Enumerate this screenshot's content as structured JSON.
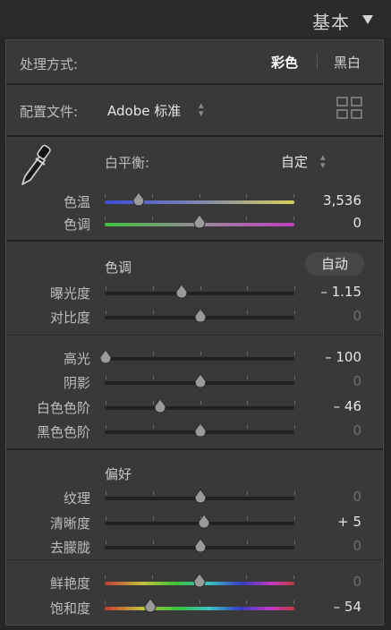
{
  "header": {
    "title": "基本"
  },
  "treatment": {
    "label": "处理方式:",
    "color": "彩色",
    "bw": "黑白"
  },
  "profile": {
    "label": "配置文件:",
    "value": "Adobe 标准"
  },
  "wb": {
    "label": "白平衡:",
    "value": "自定"
  },
  "tone": {
    "title": "色调",
    "auto": "自动"
  },
  "presence": {
    "title": "偏好"
  },
  "sliders": [
    {
      "key": "temp",
      "label": "色温",
      "value": "3,536",
      "pos": 0.18,
      "track": "temp",
      "dim": false
    },
    {
      "key": "tint",
      "label": "色调",
      "value": "0",
      "pos": 0.5,
      "track": "tint",
      "dim": false
    },
    {
      "key": "exposure",
      "label": "曝光度",
      "value": "– 1.15",
      "pos": 0.4,
      "track": "gray",
      "dim": false
    },
    {
      "key": "contrast",
      "label": "对比度",
      "value": "0",
      "pos": 0.5,
      "track": "gray",
      "dim": true
    },
    {
      "key": "highlights",
      "label": "高光",
      "value": "– 100",
      "pos": 0.0,
      "track": "gray",
      "dim": false
    },
    {
      "key": "shadows",
      "label": "阴影",
      "value": "0",
      "pos": 0.5,
      "track": "gray",
      "dim": true
    },
    {
      "key": "whites",
      "label": "白色色阶",
      "value": "– 46",
      "pos": 0.29,
      "track": "gray",
      "dim": false
    },
    {
      "key": "blacks",
      "label": "黑色色阶",
      "value": "0",
      "pos": 0.5,
      "track": "gray",
      "dim": true
    },
    {
      "key": "texture",
      "label": "纹理",
      "value": "0",
      "pos": 0.5,
      "track": "gray",
      "dim": true
    },
    {
      "key": "clarity",
      "label": "清晰度",
      "value": "+ 5",
      "pos": 0.52,
      "track": "gray",
      "dim": false
    },
    {
      "key": "dehaze",
      "label": "去朦胧",
      "value": "0",
      "pos": 0.5,
      "track": "gray",
      "dim": true
    },
    {
      "key": "vibrance",
      "label": "鲜艳度",
      "value": "0",
      "pos": 0.5,
      "track": "rainbow",
      "dim": true
    },
    {
      "key": "saturation",
      "label": "饱和度",
      "value": "– 54",
      "pos": 0.24,
      "track": "rainbow",
      "dim": false
    }
  ]
}
